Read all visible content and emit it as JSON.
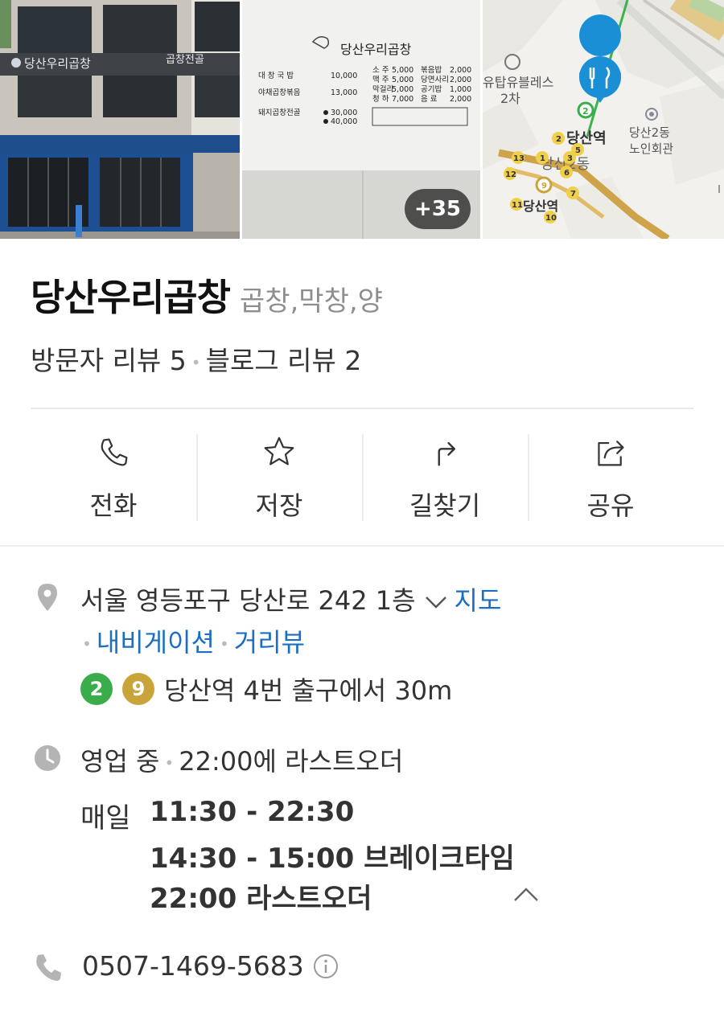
{
  "photos": {
    "storefront_sign": "당산우리곱창",
    "storefront_sign_right": "곱창전골",
    "menu_title": "당산우리곱창",
    "menu_items": [
      {
        "name": "대 창 국 밥",
        "price": "10,000"
      },
      {
        "name": "야채곱창볶음",
        "price": "13,000"
      },
      {
        "name": "돼지곱창전골",
        "price": "30,000"
      },
      {
        "name": "",
        "price": "40,000"
      }
    ],
    "drinks": [
      {
        "name": "소 주",
        "price": "5,000"
      },
      {
        "name": "맥 주",
        "price": "5,000"
      },
      {
        "name": "막걸리",
        "price": "5,000"
      },
      {
        "name": "청 하",
        "price": "7,000"
      }
    ],
    "sides": [
      {
        "name": "볶음밥",
        "price": "2,000"
      },
      {
        "name": "당면사리",
        "price": "2,000"
      },
      {
        "name": "공기밥",
        "price": "1,000"
      },
      {
        "name": "음 료",
        "price": "2,000"
      }
    ],
    "more_count": "+35",
    "map_labels": {
      "poi_top": "유탑유블레스",
      "poi_top2": "2차",
      "station": "당산역",
      "dong": "당산2동",
      "station2": "당산역",
      "community_center": "당산2동",
      "community_center2": "노인회관"
    }
  },
  "place": {
    "name": "당산우리곱창",
    "category": "곱창,막창,양",
    "visitor_reviews": "방문자 리뷰 5",
    "blog_reviews": "블로그 리뷰 2"
  },
  "actions": [
    {
      "label": "전화",
      "icon": "phone-icon"
    },
    {
      "label": "저장",
      "icon": "star-icon"
    },
    {
      "label": "길찾기",
      "icon": "directions-icon"
    },
    {
      "label": "공유",
      "icon": "share-icon"
    }
  ],
  "address": {
    "text": "서울 영등포구 당산로 242 1층",
    "map_link": "지도",
    "navigation_link": "내비게이션",
    "streetview_link": "거리뷰"
  },
  "subway": {
    "lines": [
      {
        "number": "2",
        "color": "#3aad4a"
      },
      {
        "number": "9",
        "color": "#c9a43a"
      }
    ],
    "text": "당산역 4번 출구에서 30m"
  },
  "business": {
    "status": "영업 중",
    "last_order_note": "22:00에 라스트오더",
    "day": "매일",
    "lines": [
      "11:30 - 22:30",
      "14:30 - 15:00 브레이크타임",
      "22:00 라스트오더"
    ]
  },
  "phone": {
    "number": "0507-1469-5683"
  },
  "colors": {
    "link": "#1b6ec2",
    "map_pin": "#1a8fd6",
    "icon_gray": "#b4b4b4"
  }
}
